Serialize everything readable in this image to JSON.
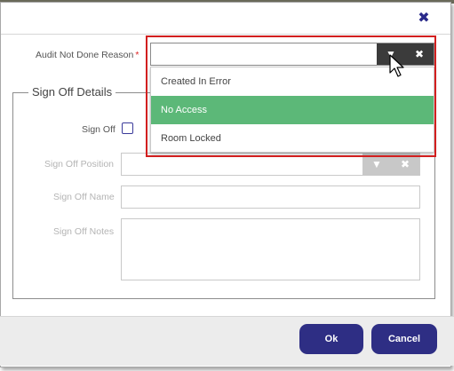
{
  "dialog": {
    "close_icon": "close-icon"
  },
  "audit": {
    "label": "Audit Not Done Reason",
    "required_marker": "*",
    "value": "",
    "dropdown": {
      "options": [
        "Created In Error",
        "No Access",
        "Room Locked"
      ],
      "selected": "No Access"
    }
  },
  "signoff": {
    "legend": "Sign Off Details",
    "checkbox_label": "Sign Off",
    "position_label": "Sign Off Position",
    "name_label": "Sign Off Name",
    "notes_label": "Sign Off Notes"
  },
  "footer": {
    "ok_label": "Ok",
    "cancel_label": "Cancel"
  },
  "colors": {
    "accent": "#2e2e84",
    "selected_option": "#5cb878",
    "highlight_border": "#d21f1f"
  }
}
